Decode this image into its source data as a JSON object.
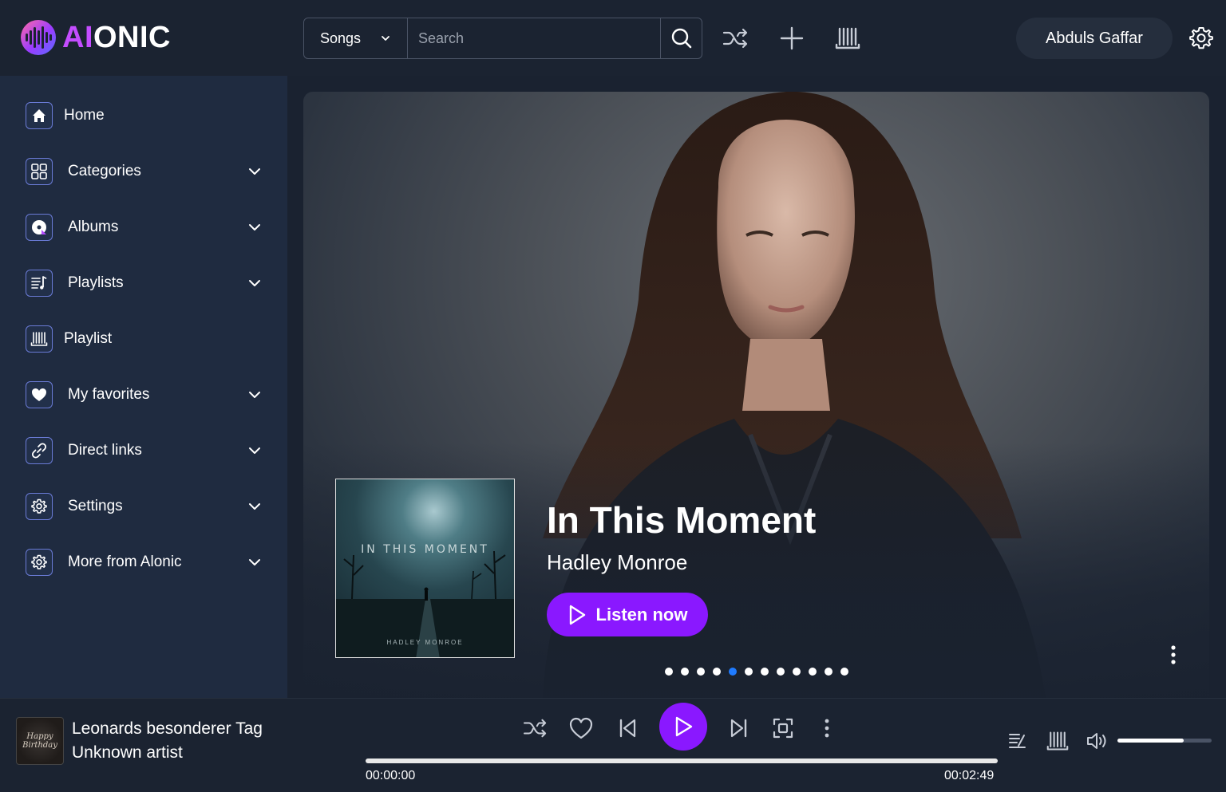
{
  "brand": {
    "logo_ai": "AI",
    "logo_rest": "ONIC"
  },
  "search": {
    "type_selected": "Songs",
    "placeholder": "Search"
  },
  "header": {
    "user_name": "Abduls Gaffar"
  },
  "sidebar": {
    "items": [
      {
        "label": "Home",
        "icon": "home-icon",
        "has_dropdown": false
      },
      {
        "label": "Categories",
        "icon": "grid-icon",
        "has_dropdown": true
      },
      {
        "label": "Albums",
        "icon": "album-icon",
        "has_dropdown": true
      },
      {
        "label": "Playlists",
        "icon": "playlists-icon",
        "has_dropdown": true
      },
      {
        "label": "Playlist",
        "icon": "library-icon",
        "has_dropdown": false
      },
      {
        "label": "My favorites",
        "icon": "heart-icon",
        "has_dropdown": true
      },
      {
        "label": "Direct links",
        "icon": "link-icon",
        "has_dropdown": true
      },
      {
        "label": "Settings",
        "icon": "gear-icon",
        "has_dropdown": true
      },
      {
        "label": "More from Alonic",
        "icon": "gear-icon",
        "has_dropdown": true
      }
    ]
  },
  "hero": {
    "title": "In This Moment",
    "artist": "Hadley Monroe",
    "cover_title": "IN THIS MOMENT",
    "cover_artist": "HADLEY MONROE",
    "cta_label": "Listen now",
    "slide_count": 12,
    "active_slide": 5
  },
  "player": {
    "track_title": "Leonards besonderer Tag",
    "track_artist": "Unknown artist",
    "thumb_text": "Happy Birthday",
    "time_current": "00:00:00",
    "time_duration": "00:02:49",
    "progress": 0,
    "volume": 0.7
  },
  "colors": {
    "accent": "#8a18ff",
    "active_dot": "#1f7bff",
    "sidebar_bg": "#1f2b40",
    "header_bg": "#1b2331"
  }
}
